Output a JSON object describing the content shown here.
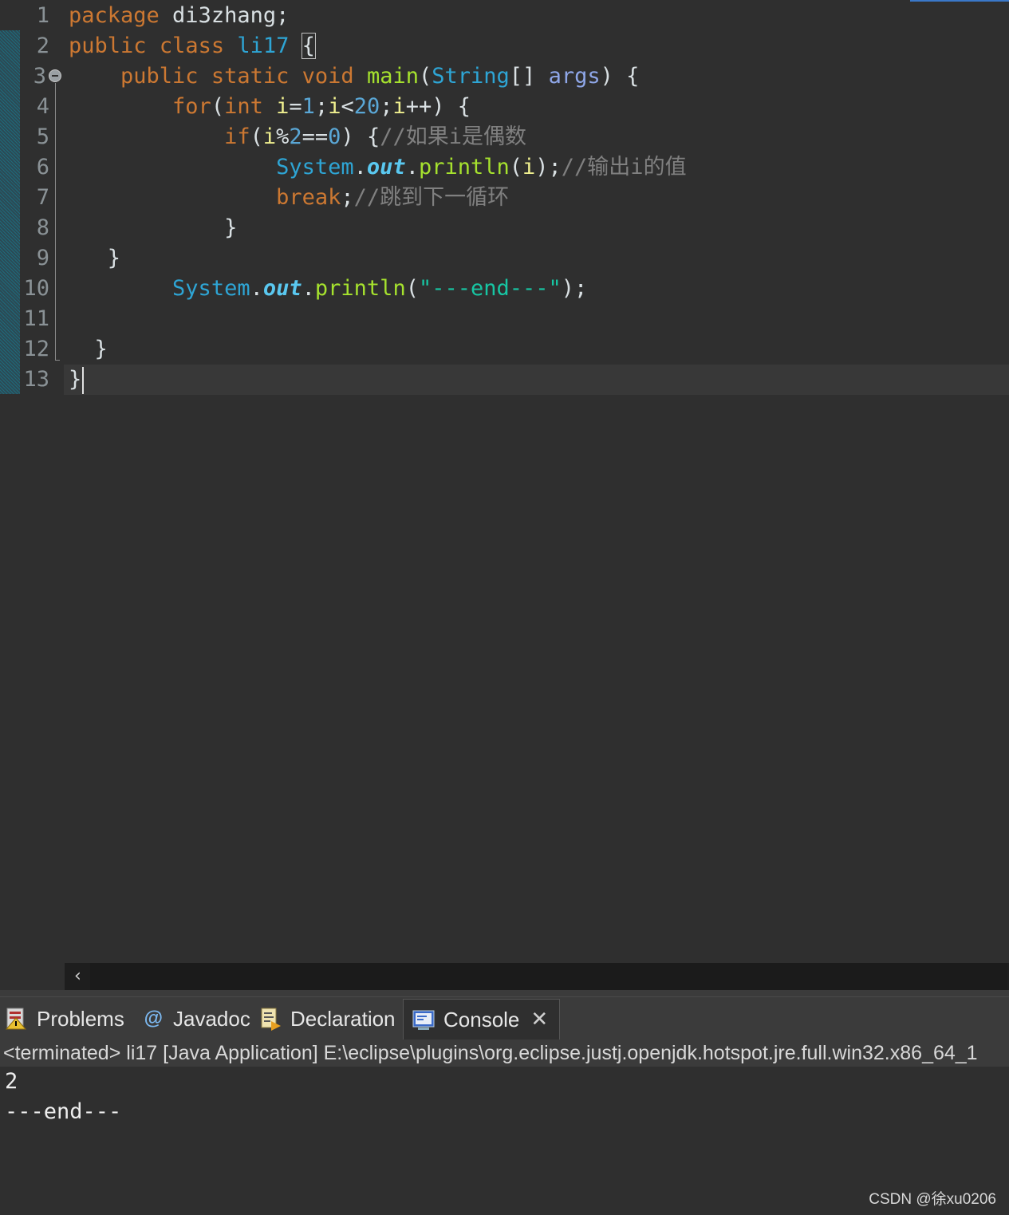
{
  "editor": {
    "line_numbers": [
      "1",
      "2",
      "3",
      "4",
      "5",
      "6",
      "7",
      "8",
      "9",
      "10",
      "11",
      "12",
      "13"
    ],
    "l1": {
      "kw": "package",
      "rest": " di3zhang;"
    },
    "l2": {
      "kw1": "public",
      "kw2": "class",
      "name": "li17",
      "brace": "{"
    },
    "l3": {
      "kw1": "public",
      "kw2": "static",
      "kw3": "void",
      "fn": "main",
      "p1": "(",
      "ty": "String",
      "p2": "[] ",
      "param": "args",
      "p3": ") {"
    },
    "l4": {
      "kw": "for",
      "p1": "(",
      "ty": "int",
      "sp": " ",
      "v1": "i",
      "op1": "=",
      "n1": "1",
      "op2": ";",
      "v2": "i",
      "op3": "<",
      "n2": "20",
      "op4": ";",
      "v3": "i",
      "op5": "++) {"
    },
    "l5": {
      "kw": "if",
      "p1": "(",
      "v": "i",
      "op1": "%",
      "n1": "2",
      "op2": "==",
      "n2": "0",
      "p2": ") {",
      "cm": "//如果i是偶数"
    },
    "l6": {
      "cls": "System",
      "dot1": ".",
      "fld": "out",
      "dot2": ".",
      "fn": "println",
      "p1": "(",
      "v": "i",
      "p2": ");",
      "cm": "//输出i的值"
    },
    "l7": {
      "kw": "break",
      "p": ";",
      "cm": "//跳到下一循环"
    },
    "l8": {
      "p": "}"
    },
    "l9": {
      "p": "}"
    },
    "l10": {
      "cls": "System",
      "dot1": ".",
      "fld": "out",
      "dot2": ".",
      "fn": "println",
      "p1": "(",
      "str": "\"---end---\"",
      "p2": ");"
    },
    "l12": {
      "p": "}"
    },
    "l13": {
      "p": "}"
    }
  },
  "scrollbar": {
    "left_arrow": "‹"
  },
  "panel": {
    "tabs": [
      {
        "label": "Problems",
        "icon": "problems-icon"
      },
      {
        "label": "Javadoc",
        "icon": "javadoc-icon"
      },
      {
        "label": "Declaration",
        "icon": "declaration-icon"
      },
      {
        "label": "Console",
        "icon": "console-icon"
      }
    ],
    "close_label": "✕",
    "status": "<terminated> li17 [Java Application] E:\\eclipse\\plugins\\org.eclipse.justj.openjdk.hotspot.jre.full.win32.x86_64_1",
    "output": [
      "2",
      "---end---"
    ]
  },
  "watermark": "CSDN @徐xu0206"
}
